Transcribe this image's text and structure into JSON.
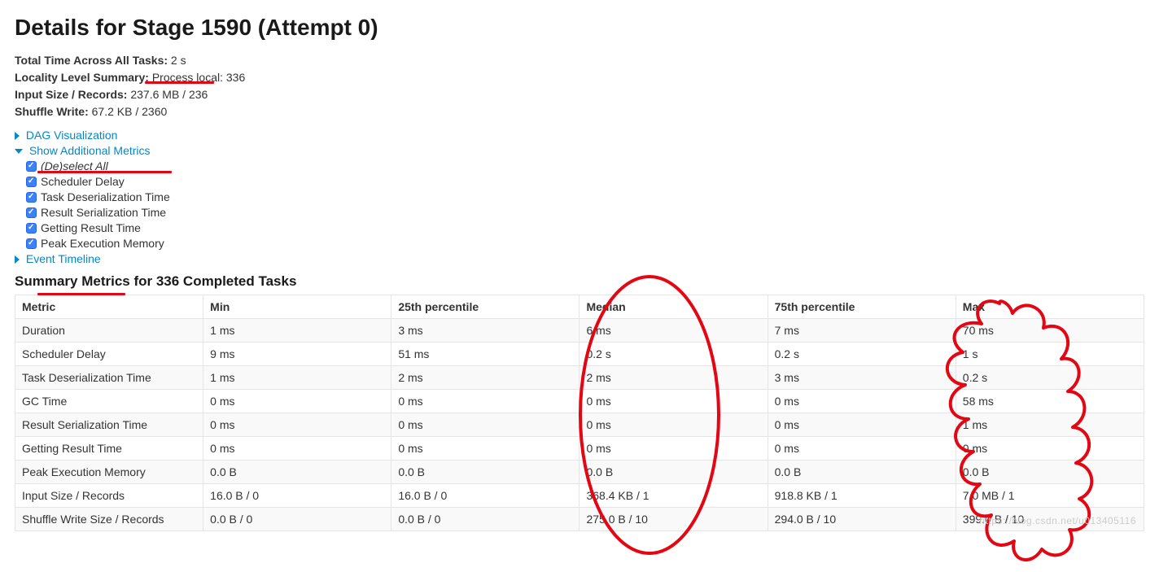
{
  "page_title": "Details for Stage 1590 (Attempt 0)",
  "summary": {
    "total_time_label": "Total Time Across All Tasks:",
    "total_time_value": "2 s",
    "locality_label": "Locality Level Summary:",
    "locality_value": "Process local: 336",
    "input_label": "Input Size / Records:",
    "input_value": "237.6 MB / 236",
    "shuffle_label": "Shuffle Write:",
    "shuffle_value": "67.2 KB / 2360"
  },
  "expand": {
    "dag_label": "DAG Visualization",
    "additional_label": "Show Additional Metrics",
    "event_label": "Event Timeline"
  },
  "checks": {
    "deselect": "(De)select All",
    "scheduler": "Scheduler Delay",
    "deser": "Task Deserialization Time",
    "resultser": "Result Serialization Time",
    "getresult": "Getting Result Time",
    "peak": "Peak Execution Memory"
  },
  "section_title": "Summary Metrics for 336 Completed Tasks",
  "table": {
    "headers": [
      "Metric",
      "Min",
      "25th percentile",
      "Median",
      "75th percentile",
      "Max"
    ],
    "rows": [
      [
        "Duration",
        "1 ms",
        "3 ms",
        "6 ms",
        "7 ms",
        "70 ms"
      ],
      [
        "Scheduler Delay",
        "9 ms",
        "51 ms",
        "0.2 s",
        "0.2 s",
        "1 s"
      ],
      [
        "Task Deserialization Time",
        "1 ms",
        "2 ms",
        "2 ms",
        "3 ms",
        "0.2 s"
      ],
      [
        "GC Time",
        "0 ms",
        "0 ms",
        "0 ms",
        "0 ms",
        "58 ms"
      ],
      [
        "Result Serialization Time",
        "0 ms",
        "0 ms",
        "0 ms",
        "0 ms",
        "1 ms"
      ],
      [
        "Getting Result Time",
        "0 ms",
        "0 ms",
        "0 ms",
        "0 ms",
        "0 ms"
      ],
      [
        "Peak Execution Memory",
        "0.0 B",
        "0.0 B",
        "0.0 B",
        "0.0 B",
        "0.0 B"
      ],
      [
        "Input Size / Records",
        "16.0 B / 0",
        "16.0 B / 0",
        "368.4 KB / 1",
        "918.8 KB / 1",
        "7.0 MB / 1"
      ],
      [
        "Shuffle Write Size / Records",
        "0.0 B / 0",
        "0.0 B / 0",
        "275.0 B / 10",
        "294.0 B / 10",
        "399.0 B / 10"
      ]
    ]
  },
  "watermark": "https://blog.csdn.net/u013405116"
}
